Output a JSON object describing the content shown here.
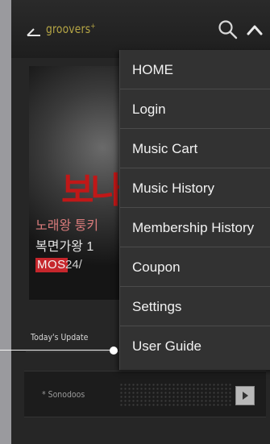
{
  "header": {
    "logo": "groovers",
    "logo_mark": "+",
    "icons": [
      "back-arrow-icon",
      "search-icon",
      "chevron-up-icon"
    ]
  },
  "banner": {
    "red_text": "보나",
    "line1": "노래왕 퉁키",
    "line2": "복면가왕 1",
    "badge": "MOS",
    "date": "24/"
  },
  "update": {
    "label": "Today's Update",
    "track_name": "* Sonodoos"
  },
  "menu": {
    "items": [
      {
        "label": "HOME"
      },
      {
        "label": "Login"
      },
      {
        "label": "Music Cart"
      },
      {
        "label": "Music History"
      },
      {
        "label": "Membership History"
      },
      {
        "label": "Coupon"
      },
      {
        "label": "Settings"
      },
      {
        "label": "User Guide"
      }
    ]
  },
  "colors": {
    "background": "#9a9a9e",
    "app_bg": "#262626",
    "menu_bg": "#323232",
    "logo": "#b5a545",
    "accent_red": "#c6262c"
  }
}
